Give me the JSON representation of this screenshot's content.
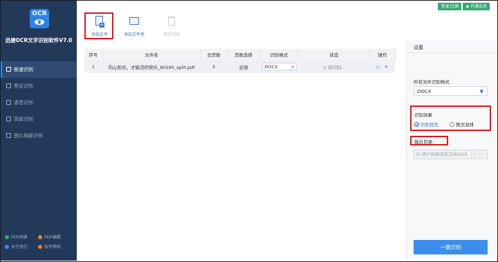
{
  "app": {
    "logo_text": "OCR",
    "title": "迅捷OCR文字识别软件V7.0"
  },
  "top_buttons": {
    "login": "登录/注册",
    "vip": "开通会员"
  },
  "sidebar": {
    "items": [
      {
        "label": "极速识别",
        "active": true
      },
      {
        "label": "票证识别"
      },
      {
        "label": "语音识别"
      },
      {
        "label": "高级识别"
      },
      {
        "label": "图片局部识别"
      }
    ],
    "bottom": [
      {
        "label": "PDF转换",
        "color": "#2fab73"
      },
      {
        "label": "PDF编辑",
        "color": "#e7832c"
      },
      {
        "label": "关于我们",
        "color": "#3c8ef0"
      },
      {
        "label": "软件帮助",
        "color": "#e7832c"
      }
    ]
  },
  "toolbar": {
    "add_file": "添加文件",
    "add_folder": "添加文件夹",
    "clear_list": "清空列表"
  },
  "table": {
    "headers": [
      "序号",
      "文件名",
      "总页数",
      "页数选择",
      "识别格式",
      "状态",
      "操作"
    ],
    "rows": [
      {
        "index": "1",
        "filename": "内心阳光，才能活的快乐_80590_split.pdf",
        "pages": "3",
        "page_select": "全部",
        "format": "DOCX",
        "status": "待识别..."
      }
    ]
  },
  "settings": {
    "title": "设置",
    "format_label": "所有文件识别格式",
    "format_value": "DOCX",
    "effect_label": "识别效果",
    "effect_options": [
      "识别优先",
      "图文混排"
    ],
    "effect_selected": "识别优先",
    "output_label": "输出目录：",
    "output_path": "D:\\用户目录\\我的文档\\OCR",
    "browse_button": "···",
    "run_button": "一键识别"
  },
  "colors": {
    "sidebar": "#23395a",
    "accent": "#3d8eec",
    "highlight": "#e0151d",
    "green": "#2fab73"
  }
}
